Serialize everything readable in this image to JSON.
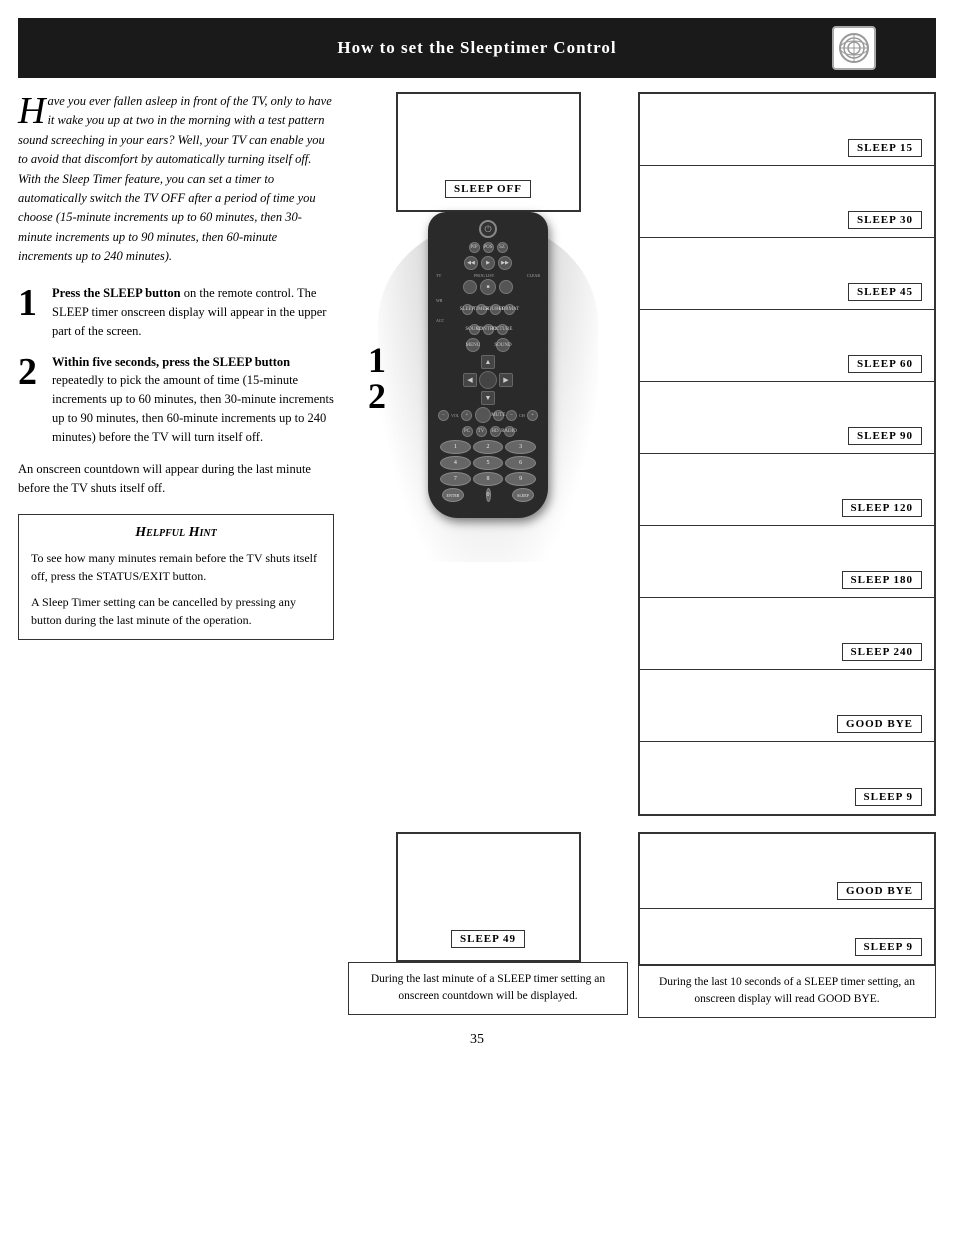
{
  "header": {
    "title": "How to set the Sleeptimer Control"
  },
  "intro": {
    "drop_cap": "H",
    "text": "ave you ever fallen asleep in front of the TV, only to have it wake you up at two in the morning with a test pattern sound screeching in your ears?  Well, your TV can enable you to avoid that discomfort by automatically turning itself off. With the Sleep Timer feature, you can set a timer to automatically switch the TV OFF after a period of time you choose (15-minute increments up to 60 minutes, then 30-minute increments up to 90 minutes, then 60-minute increments up to 240 minutes)."
  },
  "steps": [
    {
      "num": "1",
      "text_html": "Press the SLEEP button on the remote control.  The SLEEP timer onscreen display will appear in the upper part of the screen."
    },
    {
      "num": "2",
      "text_html": "Within five seconds, press the SLEEP button repeatedly to pick the amount of time (15-minute increments up to 60 minutes, then 30-minute increments up to 90 minutes, then 60-minute increments up to 240 minutes) before the TV will turn itself off."
    }
  ],
  "countdown_note": "An onscreen countdown will appear during the last minute before the TV shuts itself off.",
  "hint": {
    "title": "Helpful Hint",
    "lines": [
      "To see how many minutes remain before the TV shuts itself off, press the STATUS/EXIT button.",
      "A Sleep Timer setting can be cancelled by pressing any button during the last minute of the operation."
    ]
  },
  "screens": {
    "top_label": "SLEEP  OFF",
    "bottom_label": "SLEEP  49",
    "bottom_right_label": "GOOD  BYE",
    "bottom_right_label2": "SLEEP  9"
  },
  "sleep_panels": [
    {
      "label": "SLEEP  15"
    },
    {
      "label": "SLEEP  30"
    },
    {
      "label": "SLEEP  45"
    },
    {
      "label": "SLEEP  60"
    },
    {
      "label": "SLEEP  90"
    },
    {
      "label": "SLEEP  120"
    },
    {
      "label": "SLEEP  180"
    },
    {
      "label": "SLEEP  240"
    },
    {
      "label": "GOOD  BYE"
    },
    {
      "label": "SLEEP  9"
    }
  ],
  "captions": {
    "bottom_left": "During the last minute of a SLEEP timer setting an onscreen countdown will be displayed.",
    "bottom_right": "During the last 10 seconds of a SLEEP timer setting, an onscreen display will read GOOD BYE."
  },
  "page_number": "35"
}
